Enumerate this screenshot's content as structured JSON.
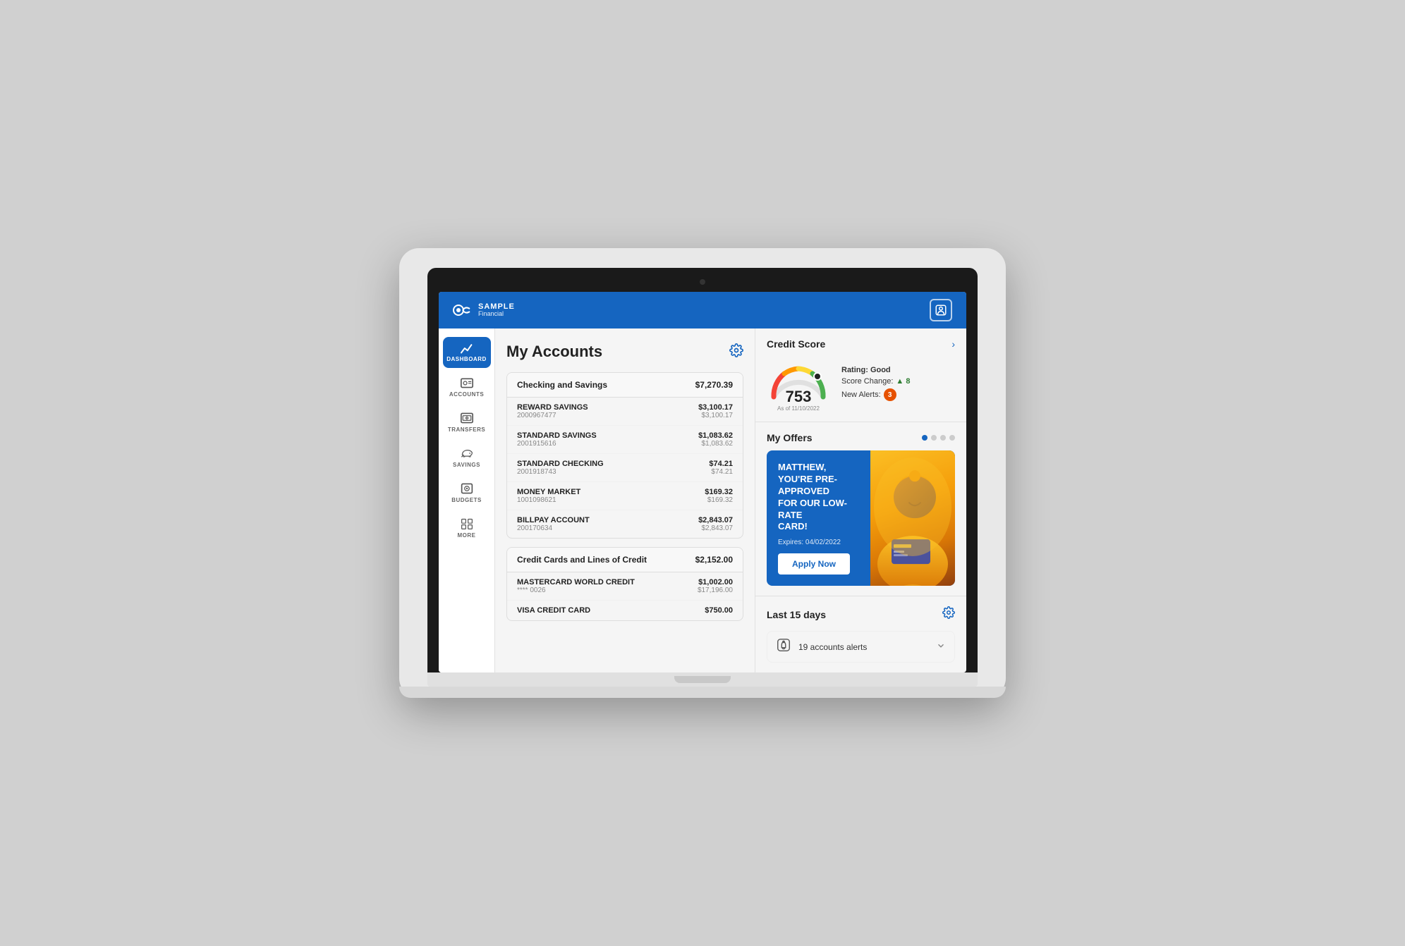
{
  "app": {
    "title": "Sample Financial",
    "brand_sample": "SAMPLE",
    "brand_financial": "Financial"
  },
  "nav": {
    "user_icon": "👤"
  },
  "sidebar": {
    "items": [
      {
        "id": "dashboard",
        "label": "DASHBOARD",
        "icon": "📈",
        "active": true
      },
      {
        "id": "accounts",
        "label": "ACCOUNTS",
        "icon": "💳",
        "active": false
      },
      {
        "id": "transfers",
        "label": "TRANSFERS",
        "icon": "🔄",
        "active": false
      },
      {
        "id": "savings",
        "label": "SAVINGS",
        "icon": "🐷",
        "active": false
      },
      {
        "id": "budgets",
        "label": "BUDGETS",
        "icon": "🎯",
        "active": false
      },
      {
        "id": "more",
        "label": "MORE",
        "icon": "⊞",
        "active": false
      }
    ]
  },
  "main": {
    "page_title": "My Accounts",
    "checking_savings": {
      "label": "Checking and Savings",
      "total": "$7,270.39",
      "accounts": [
        {
          "name": "REWARD SAVINGS",
          "number": "2000967477",
          "balance": "$3,100.17",
          "available": "$3,100.17"
        },
        {
          "name": "STANDARD SAVINGS",
          "number": "2001915616",
          "balance": "$1,083.62",
          "available": "$1,083.62"
        },
        {
          "name": "STANDARD CHECKING",
          "number": "2001918743",
          "balance": "$74.21",
          "available": "$74.21"
        },
        {
          "name": "MONEY MARKET",
          "number": "1001098621",
          "balance": "$169.32",
          "available": "$169.32"
        },
        {
          "name": "BILLPAY ACCOUNT",
          "number": "200170634",
          "balance": "$2,843.07",
          "available": "$2,843.07"
        }
      ]
    },
    "credit_section": {
      "label": "Credit Cards and Lines of Credit",
      "total": "$2,152.00",
      "accounts": [
        {
          "name": "MASTERCARD WORLD CREDIT",
          "number": "**** 0026",
          "balance": "$1,002.00",
          "available": "$17,196.00"
        },
        {
          "name": "VISA CREDIT CARD",
          "number": "",
          "balance": "$750.00",
          "available": ""
        }
      ]
    }
  },
  "credit_score": {
    "title": "Credit Score",
    "score": "753",
    "rating": "Rating: Good",
    "score_change_label": "Score Change:",
    "score_change_value": "▲ 8",
    "new_alerts_label": "New Alerts:",
    "new_alerts_count": "3",
    "as_of": "As of 11/10/2022"
  },
  "my_offers": {
    "title": "My Offers",
    "dots": [
      true,
      false,
      false,
      false
    ],
    "offer": {
      "headline": "MATTHEW,\nYOU'RE PRE-APPROVED\nFOR OUR LOW-RATE\nCARD!",
      "expires": "Expires: 04/02/2022",
      "button_label": "Apply Now"
    }
  },
  "last_days": {
    "title": "Last 15 days",
    "alerts_text": "19 accounts alerts"
  }
}
